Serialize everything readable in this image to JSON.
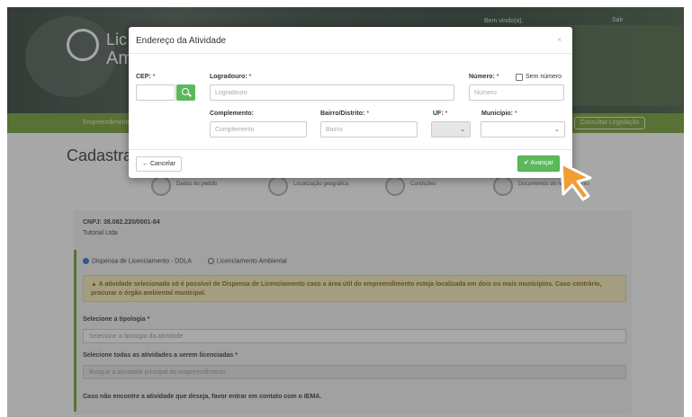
{
  "background": {
    "header": {
      "logo_line1": "Lic",
      "logo_line2": "Am",
      "welcome": "Bem vindo(a),",
      "exit": "Sair"
    },
    "navbar": {
      "left_item": "Empreendimento",
      "right_button": "Consultar Legislação"
    },
    "page_title": "Cadastra",
    "steps": [
      {
        "label": "Dados do pedido"
      },
      {
        "label": "Localização geográfica"
      },
      {
        "label": "Condições"
      },
      {
        "label": "Documentos do requerimento"
      }
    ],
    "company": {
      "cnpj": "CNPJ: 38.082.220/0001-84",
      "name": "Tutorial Ltda"
    },
    "license_options": [
      {
        "label": "Dispensa de Licenciamento - DDLA",
        "selected": true
      },
      {
        "label": "Licenciamento Ambiental",
        "selected": false
      }
    ],
    "alert": "A atividade selecionada só é possível de Dispensa de Licenciamento caso a área útil do empreendimento esteja localizada em dois ou mais municípios. Caso contrário, procurar o órgão ambiental municipal.",
    "tipologia_label": "Selecione a tipologia *",
    "tipologia_placeholder": "Selecione a tipologia da atividade",
    "atividades_label": "Selecione todas as atividades a serem licenciadas *",
    "atividades_placeholder": "Busque a atividade principal do empreendimento",
    "footer_note": "Caso não encontre a atividade que deseja, favor entrar em contato com o IEMA."
  },
  "modal": {
    "title": "Endereço da Atividade",
    "close": "×",
    "fields": {
      "cep": {
        "label": "CEP:",
        "required": "*",
        "value": "",
        "placeholder": ""
      },
      "logradouro": {
        "label": "Logradouro:",
        "required": "*",
        "placeholder": "Logradouro"
      },
      "numero": {
        "label": "Número:",
        "required": "*",
        "placeholder": "Número"
      },
      "sem_numero": {
        "label": "Sem número",
        "checked": false
      },
      "complemento": {
        "label": "Complemento:",
        "placeholder": "Complemento"
      },
      "bairro": {
        "label": "Bairro/Distrito:",
        "required": "*",
        "placeholder": "Bairro"
      },
      "uf": {
        "label": "UF:",
        "required": "*",
        "value": ""
      },
      "municipio": {
        "label": "Município:",
        "required": "*",
        "value": ""
      }
    },
    "cancel_label": "← Cancelar",
    "next_label": "✔ Avançar"
  },
  "colors": {
    "primary_green": "#5cb85c",
    "navbar_green": "#6f9d2f",
    "required_red": "#d9534f",
    "cursor_orange": "#f39c34"
  },
  "icons": [
    "search-icon",
    "check-icon",
    "arrow-left-icon",
    "cursor-pointer-icon",
    "chevron-down-icon"
  ]
}
